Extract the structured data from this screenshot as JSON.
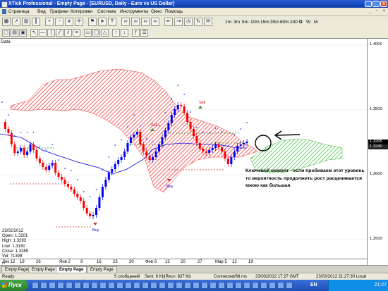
{
  "window": {
    "title": "XTick Professional - Empty Page - [EURUSD, Daily - Euro vs US Dollar]",
    "controls": [
      "_",
      "□",
      "x"
    ]
  },
  "menu": {
    "items": [
      "Страница",
      "Вид",
      "Графики",
      "Котировки",
      "Система",
      "Инструменты",
      "Окно",
      "Помощь"
    ]
  },
  "toolbar": {
    "timeframes": [
      "1m",
      "3m",
      "5m",
      "10m",
      "15m",
      "30m",
      "60m",
      "240",
      "D",
      "W",
      "M"
    ]
  },
  "chart": {
    "label": "Data",
    "info": {
      "date": "23/02/2012",
      "open": "Open: 1.3201",
      "high": "High: 1.3293",
      "low": "Low: 1.3180",
      "close": "Close: 1.3265",
      "vol": "Vol: 71399"
    },
    "annotation": "Ключевой момент - если пробиваем этот уровень то вероятность продолжить рост расценивается мною как большая",
    "signals": [
      "Sell",
      "Sell",
      "Buy",
      "Buy"
    ],
    "price_axis": [
      "1.4000",
      "1.3500",
      "1.3265",
      "1.3240",
      "1.3000",
      "1.2500"
    ],
    "time_axis": [
      "Дек 12",
      "19",
      "26",
      "Янв 2",
      "9",
      "16",
      "23",
      "30",
      "Фев 6",
      "13",
      "20",
      "27",
      "Мар 5",
      "12",
      "19"
    ],
    "current_price": "1.3265",
    "secondary_price": "1.3240",
    "colors": {
      "bull": "#0000ff",
      "bear": "#ff0000",
      "kumo_bear": "#ee3333",
      "kumo_bull": "#33bb33",
      "kijun": "#0000ee",
      "tenkan": "#e60000"
    }
  },
  "tabs": [
    "Empty Page",
    "Empty Page",
    "Empty Page",
    "Empty Page"
  ],
  "status": {
    "ready": "Ready",
    "messages": "5 сообщений",
    "traffic": "Sent: 6 Kb|Recv: 837 Kb",
    "connected": "Connected/68 ms",
    "server_time": "23/03/2012 17:27 GMT",
    "local_time": "23/03/2012 21:27:30 Local"
  },
  "taskbar": {
    "start": "Пуск",
    "lang": "EN",
    "clock": "21:27"
  }
}
